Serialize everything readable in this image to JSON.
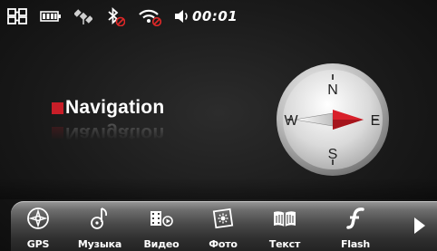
{
  "status_bar": {
    "icons": [
      "network-icon",
      "battery-icon",
      "gps-satellite-icon",
      "bluetooth-off-icon",
      "wifi-off-icon",
      "speaker-icon"
    ],
    "time": "00:01"
  },
  "main": {
    "title": "Navigation",
    "compass": {
      "north": "N",
      "south": "S",
      "east": "E",
      "west": "W"
    }
  },
  "dock": {
    "items": [
      {
        "label": "GPS",
        "icon": "gps-icon"
      },
      {
        "label": "Музыка",
        "icon": "music-icon"
      },
      {
        "label": "Видео",
        "icon": "video-icon"
      },
      {
        "label": "Фото",
        "icon": "photo-icon"
      },
      {
        "label": "Текст",
        "icon": "text-book-icon"
      },
      {
        "label": "Flash",
        "icon": "flash-icon"
      }
    ],
    "next_icon": "next-arrow-icon"
  },
  "colors": {
    "accent": "#c81e28",
    "text": "#ffffff",
    "background": "#1a1a1a"
  }
}
